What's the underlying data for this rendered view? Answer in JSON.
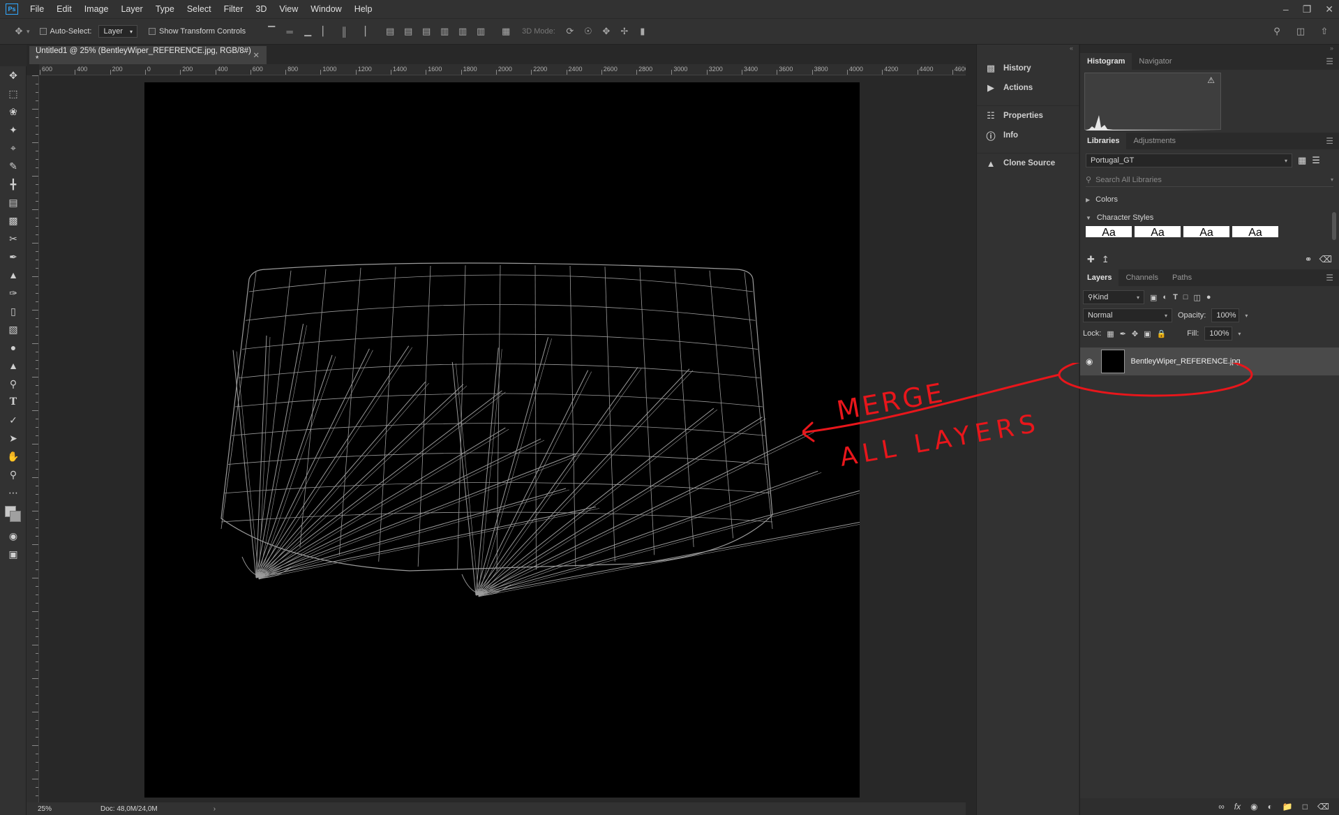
{
  "menubar": {
    "logo": "Ps",
    "items": [
      "File",
      "Edit",
      "Image",
      "Layer",
      "Type",
      "Select",
      "Filter",
      "3D",
      "View",
      "Window",
      "Help"
    ]
  },
  "options": {
    "auto_select_label": "Auto-Select:",
    "auto_select_value": "Layer",
    "show_transform_label": "Show Transform Controls",
    "mode_3d_label": "3D Mode:"
  },
  "document": {
    "tab_title": "Untitled1 @ 25% (BentleyWiper_REFERENCE.jpg, RGB/8#) *",
    "ruler_h": [
      "600",
      "400",
      "200",
      "0",
      "200",
      "400",
      "600",
      "800",
      "1000",
      "1200",
      "1400",
      "1600",
      "1800",
      "2000",
      "2200",
      "2400",
      "2600",
      "2800",
      "3000",
      "3200",
      "3400",
      "3600",
      "3800",
      "4000",
      "4200",
      "4400",
      "4600"
    ],
    "zoom": "25%",
    "doc_size": "Doc: 48,0M/24,0M"
  },
  "side_panels": [
    "History",
    "Actions",
    "Properties",
    "Info",
    "Clone Source"
  ],
  "histogram": {
    "tabs": [
      "Histogram",
      "Navigator"
    ]
  },
  "libraries": {
    "tabs": [
      "Libraries",
      "Adjustments"
    ],
    "library_name": "Portugal_GT",
    "search_placeholder": "Search All Libraries",
    "sections": [
      "Colors",
      "Character Styles"
    ],
    "style_sample": "Aa"
  },
  "layers": {
    "tabs": [
      "Layers",
      "Channels",
      "Paths"
    ],
    "filter_kind": "Kind",
    "blend_mode": "Normal",
    "opacity_label": "Opacity:",
    "opacity_value": "100%",
    "lock_label": "Lock:",
    "fill_label": "Fill:",
    "fill_value": "100%",
    "items": [
      {
        "name": "BentleyWiper_REFERENCE.jpg"
      }
    ]
  },
  "annotation": {
    "line1": "MERGE",
    "line2": "ALL LAYERS",
    "color": "#e8161b"
  }
}
